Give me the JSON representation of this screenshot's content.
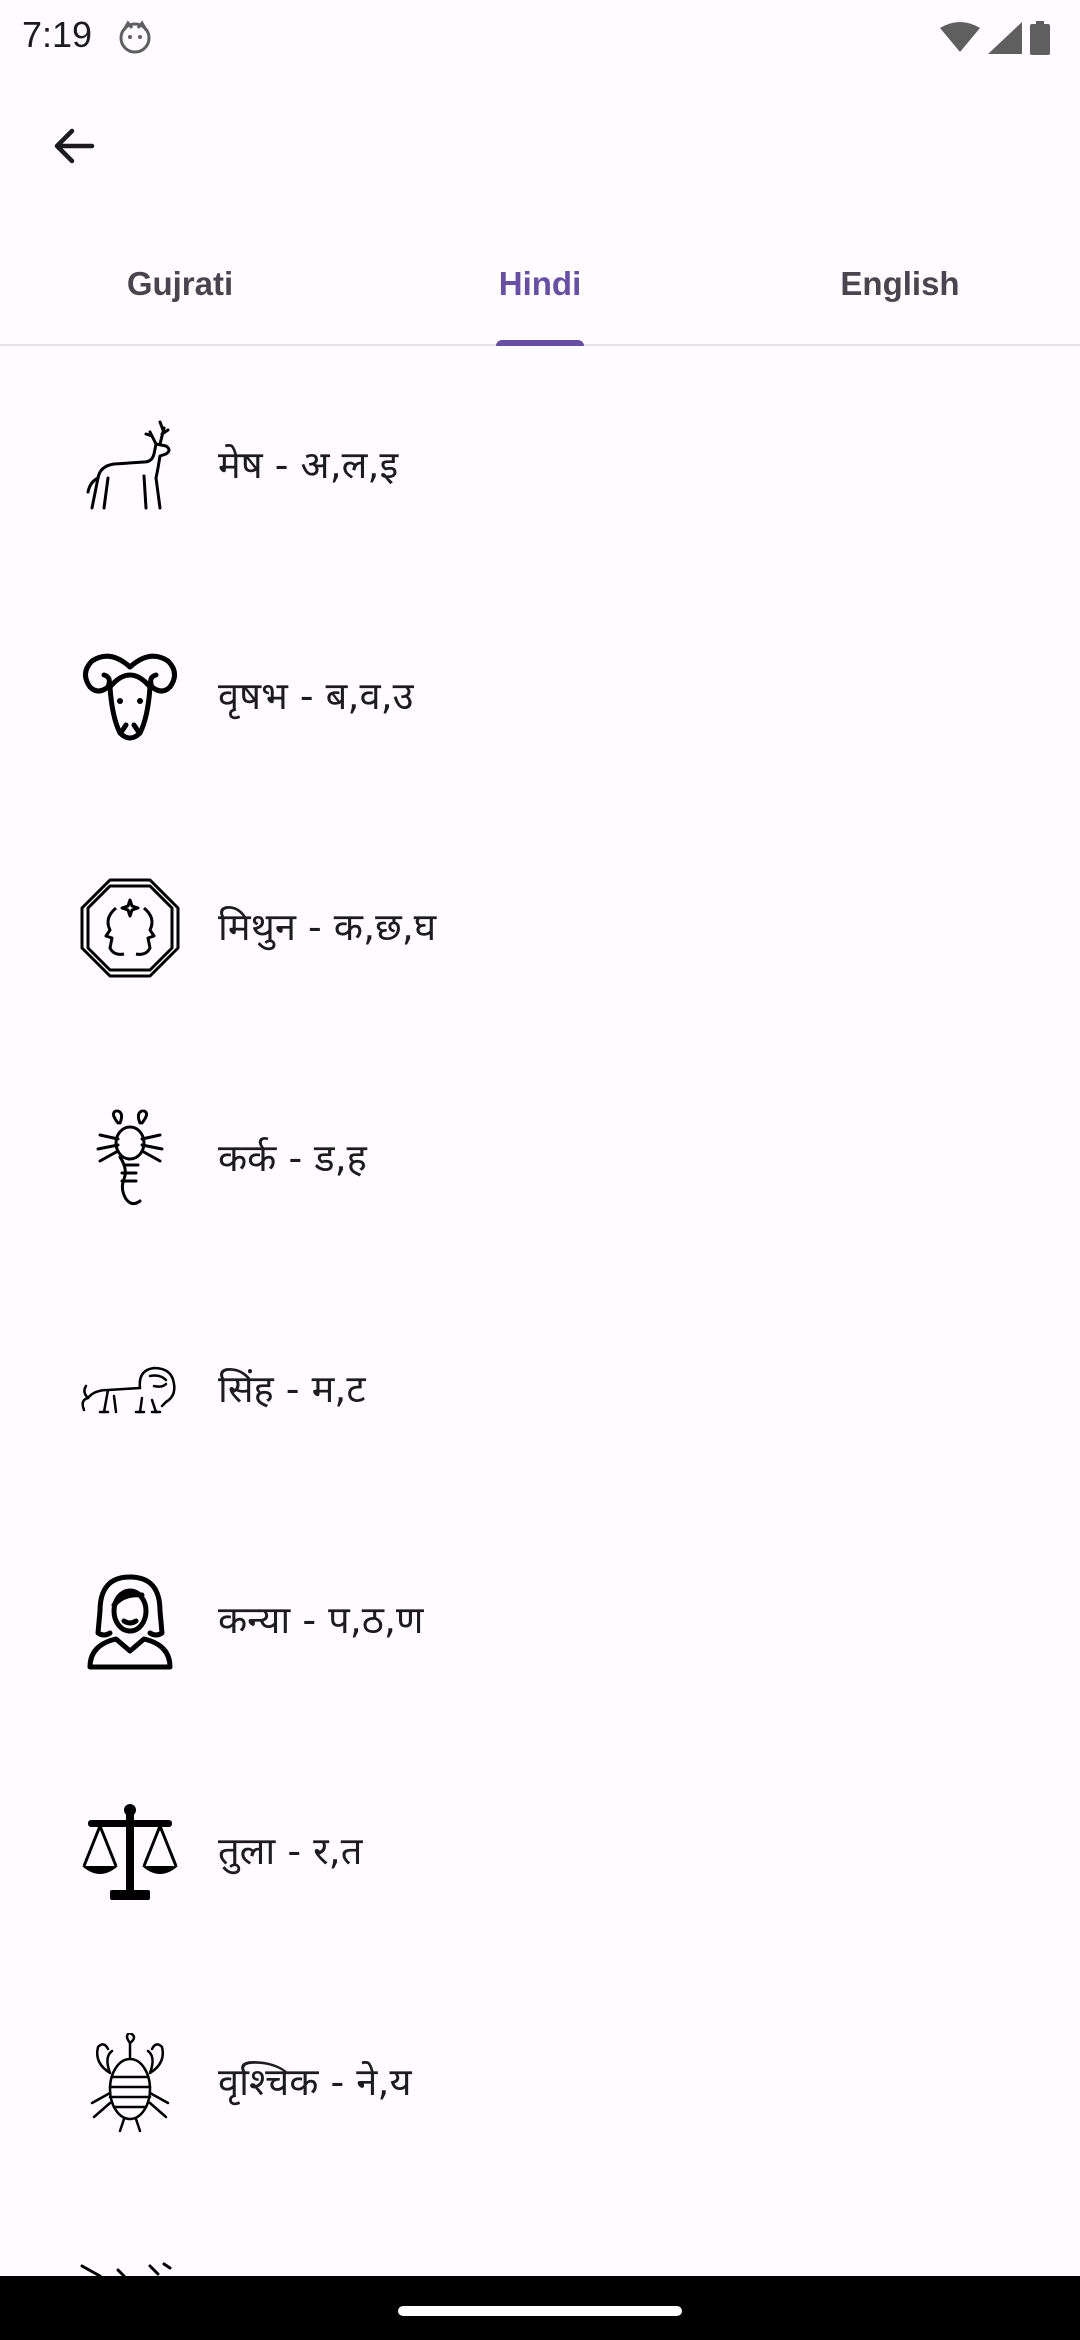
{
  "status_bar": {
    "time": "7:19",
    "icons": [
      "face-icon",
      "wifi-icon",
      "signal-icon",
      "battery-icon"
    ]
  },
  "top_bar": {
    "back_icon": "arrow-left-icon"
  },
  "tabs": [
    {
      "label": "Gujrati",
      "active": false
    },
    {
      "label": "Hindi",
      "active": true
    },
    {
      "label": "English",
      "active": false
    }
  ],
  "rashi_list": [
    {
      "icon": "deer-icon",
      "label": "मेष - अ,ल,इ"
    },
    {
      "icon": "ram-icon",
      "label": "वृषभ - ब,व,उ"
    },
    {
      "icon": "twins-icon",
      "label": "मिथुन - क,छ,घ"
    },
    {
      "icon": "crab-icon",
      "label": "कर्क - ड,ह"
    },
    {
      "icon": "lion-icon",
      "label": "सिंह - म,ट"
    },
    {
      "icon": "maiden-icon",
      "label": "कन्या - प,ठ,ण"
    },
    {
      "icon": "scales-icon",
      "label": "तुला - र,त"
    },
    {
      "icon": "scorpion-icon",
      "label": "वृश्चिक - ने,य"
    }
  ],
  "colors": {
    "accent": "#6750a4",
    "background": "#fffbfe",
    "text": "#1c1b1f",
    "tab_inactive": "#49454f"
  }
}
